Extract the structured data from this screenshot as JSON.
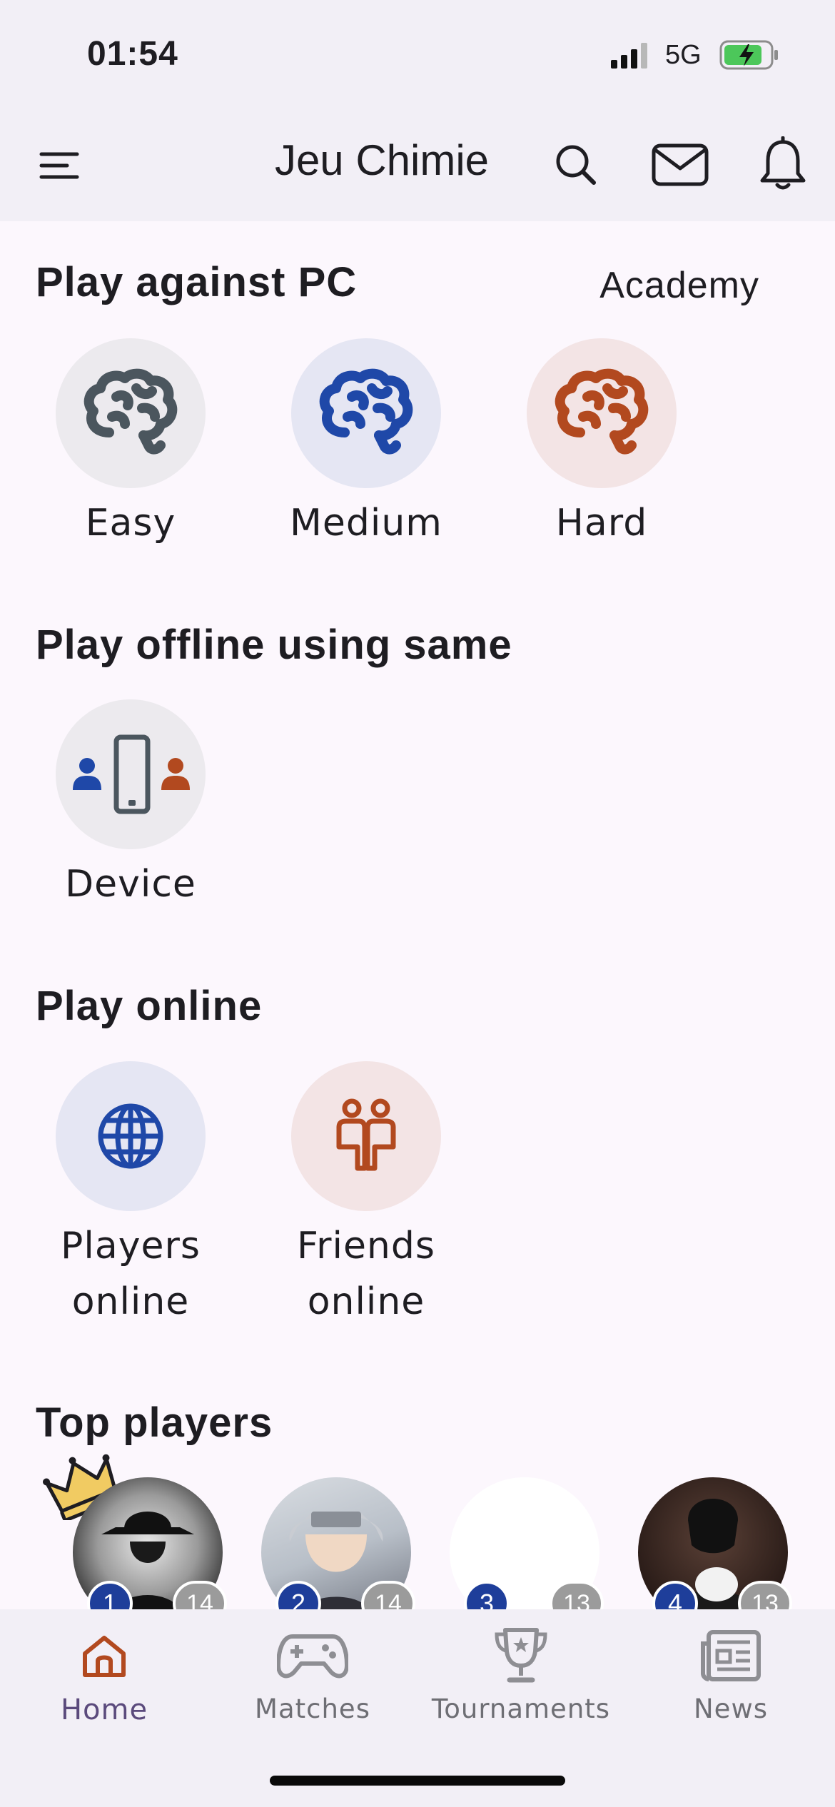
{
  "status_bar": {
    "time": "01:54",
    "network": "5G"
  },
  "app_bar": {
    "title": "Jeu Chimie"
  },
  "sections": {
    "pc": {
      "title": "Play against PC",
      "link": "Academy"
    },
    "offline": {
      "title": "Play offline using same"
    },
    "online": {
      "title": "Play online"
    },
    "top": {
      "title": "Top players"
    }
  },
  "pc_modes": [
    {
      "label": "Easy",
      "color": "#4B565E",
      "bg": "#ECEAEE"
    },
    {
      "label": "Medium",
      "color": "#1F48A8",
      "bg": "#E5E6F3"
    },
    {
      "label": "Hard",
      "color": "#B2491F",
      "bg": "#F3E4E5"
    }
  ],
  "offline_modes": [
    {
      "label": "Device"
    }
  ],
  "online_modes": [
    {
      "label_line1": "Players",
      "label_line2": "online"
    },
    {
      "label_line1": "Friends",
      "label_line2": "online"
    }
  ],
  "top_players": [
    {
      "rank": "1",
      "score": "14"
    },
    {
      "rank": "2",
      "score": "14"
    },
    {
      "rank": "3",
      "score": "13"
    },
    {
      "rank": "4",
      "score": "13"
    }
  ],
  "bottom_nav": [
    {
      "label": "Home",
      "icon": "home-icon",
      "active": true
    },
    {
      "label": "Matches",
      "icon": "gamepad-icon"
    },
    {
      "label": "Tournaments",
      "icon": "trophy-icon"
    },
    {
      "label": "News",
      "icon": "newspaper-icon"
    }
  ],
  "colors": {
    "accent": "#B2491F",
    "blue": "#1F48A8",
    "background": "#FCF7FD",
    "bar": "#F2EFF6"
  }
}
